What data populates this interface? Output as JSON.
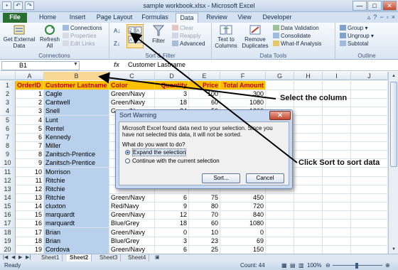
{
  "window": {
    "title": "sample workbook.xlsx - Microsoft Excel",
    "qat": [
      "save-icon",
      "undo-icon",
      "redo-icon"
    ],
    "controls": [
      "—",
      "□",
      "✕"
    ]
  },
  "tabs": [
    {
      "label": "File"
    },
    {
      "label": "Home"
    },
    {
      "label": "Insert"
    },
    {
      "label": "Page Layout"
    },
    {
      "label": "Formulas"
    },
    {
      "label": "Data"
    },
    {
      "label": "Review"
    },
    {
      "label": "View"
    },
    {
      "label": "Developer"
    }
  ],
  "ribbon": {
    "connections": {
      "label": "Connections",
      "get_external": "Get External Data",
      "refresh": "Refresh All",
      "connections_btn": "Connections",
      "properties": "Properties",
      "edit_links": "Edit Links"
    },
    "sort_filter": {
      "label": "Sort & Filter",
      "filter": "Filter",
      "clear": "Clear",
      "reapply": "Reapply",
      "advanced": "Advanced"
    },
    "data_tools": {
      "label": "Data Tools",
      "text_to_columns": "Text to Columns",
      "remove_duplicates": "Remove Duplicates",
      "data_validation": "Data Validation",
      "consolidate": "Consolidate",
      "what_if": "What-If Analysis"
    },
    "outline": {
      "label": "Outline",
      "group": "Group",
      "ungroup": "Ungroup",
      "subtotal": "Subtotal"
    }
  },
  "formula_bar": {
    "name_box": "B1",
    "fx": "fx",
    "value": "Customer Lastname"
  },
  "columns": [
    "A",
    "B",
    "C",
    "D",
    "E",
    "F",
    "G",
    "H",
    "I",
    "J"
  ],
  "rows": [
    [
      "1",
      "OrderID",
      "Customer Lastname",
      "Color",
      "Quantity",
      "Price",
      "Total Amount"
    ],
    [
      "2",
      "1",
      "Cagle",
      "Green/Navy",
      "3",
      "100",
      "300"
    ],
    [
      "3",
      "2",
      "Cantwell",
      "Green/Navy",
      "18",
      "60",
      "1080"
    ],
    [
      "4",
      "3",
      "Snell",
      "Green/Navy",
      "24",
      "50",
      "1200"
    ],
    [
      "5",
      "4",
      "Lunt",
      "",
      "",
      "",
      ""
    ],
    [
      "6",
      "5",
      "Rentel",
      "",
      "",
      "",
      ""
    ],
    [
      "7",
      "6",
      "Kennedy",
      "",
      "",
      "",
      ""
    ],
    [
      "8",
      "7",
      "Miller",
      "",
      "",
      "",
      ""
    ],
    [
      "9",
      "8",
      "Zanitsch-Prentice",
      "",
      "",
      "",
      ""
    ],
    [
      "10",
      "9",
      "Zanitsch-Prentice",
      "",
      "",
      "",
      ""
    ],
    [
      "11",
      "10",
      "Morrison",
      "",
      "",
      "",
      ""
    ],
    [
      "12",
      "11",
      "Ritchie",
      "",
      "",
      "",
      ""
    ],
    [
      "13",
      "12",
      "Ritchie",
      "",
      "",
      "",
      ""
    ],
    [
      "14",
      "13",
      "Ritchie",
      "Green/Navy",
      "6",
      "75",
      "450"
    ],
    [
      "15",
      "14",
      "cluxton",
      "Red/Navy",
      "9",
      "80",
      "720"
    ],
    [
      "16",
      "15",
      "marquardt",
      "Green/Navy",
      "12",
      "70",
      "840"
    ],
    [
      "17",
      "16",
      "marquardt",
      "Blue/Grey",
      "18",
      "60",
      "1080"
    ],
    [
      "18",
      "17",
      "Brian",
      "Green/Navy",
      "0",
      "10",
      "0"
    ],
    [
      "19",
      "18",
      "Brian",
      "Blue/Grey",
      "3",
      "23",
      "69"
    ],
    [
      "20",
      "19",
      "Cordova",
      "Green/Navy",
      "6",
      "25",
      "150"
    ]
  ],
  "sheets": [
    "Sheet1",
    "Sheet2",
    "Sheet3",
    "Sheet4"
  ],
  "active_sheet": "Sheet2",
  "status": {
    "mode": "Ready",
    "count": "Count: 44",
    "zoom": "100%"
  },
  "dialog": {
    "title": "Sort Warning",
    "close": "✕",
    "message": "Microsoft Excel found data next to your selection.  Since you have not selected this data, it will not be sorted.",
    "question": "What do you want to do?",
    "option_expand": "Expand the selection",
    "option_continue": "Continue with the current selection",
    "sort_button": "Sort...",
    "cancel_button": "Cancel"
  },
  "callouts": {
    "select_column": "Select the column",
    "click_sort": "Click Sort to sort data"
  },
  "colors": {
    "header_fill": "#ffc000",
    "header_text": "#c00000",
    "selection": "#b8d0ec",
    "file_tab": "#2a6f32"
  }
}
